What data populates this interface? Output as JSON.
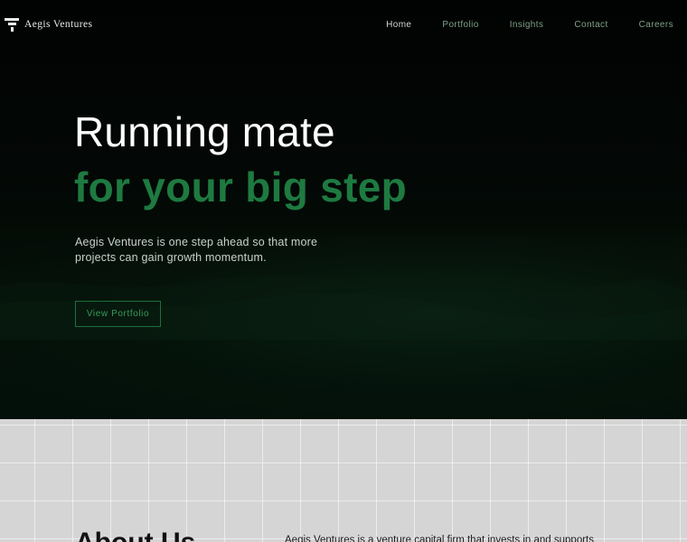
{
  "brand": {
    "name": "Aegis Ventures",
    "logo_icon": "aegis-logo-icon"
  },
  "nav": {
    "items": [
      {
        "label": "Home",
        "active": true
      },
      {
        "label": "Portfolio",
        "active": false
      },
      {
        "label": "Insights",
        "active": false
      },
      {
        "label": "Contact",
        "active": false
      },
      {
        "label": "Careers",
        "active": false
      }
    ]
  },
  "hero": {
    "line1": "Running mate",
    "line2": "for your big step",
    "description": "Aegis Ventures is one step ahead so that more projects can gain growth momentum.",
    "cta_label": "View Portfolio"
  },
  "about": {
    "title": "About Us",
    "text": "Aegis Ventures is a venture capital firm that invests in and supports"
  },
  "colors": {
    "accent_green": "#1e7a40",
    "hero_background": "#020604",
    "about_background": "#d5d5d5",
    "nav_link": "#7fa08c"
  }
}
